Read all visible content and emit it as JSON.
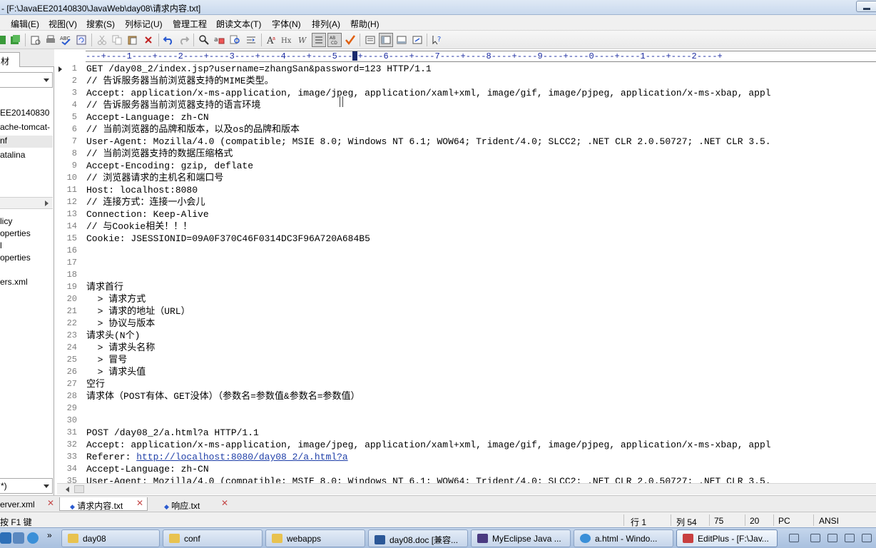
{
  "window": {
    "title": "- [F:\\JavaEE20140830\\JavaWeb\\day08\\请求内容.txt]"
  },
  "menu": [
    "编辑(E)",
    "视图(V)",
    "搜索(S)",
    "列标记(U)",
    "管理工程",
    "朗读文本(T)",
    "字体(N)",
    "排列(A)",
    "帮助(H)"
  ],
  "left_panel": {
    "tab_label": "材",
    "tree_items": [
      "EE20140830",
      "ache-tomcat-",
      "nf",
      "atalina"
    ],
    "file_items": [
      "licy",
      "operties",
      "l",
      "operties",
      "ers.xml"
    ],
    "filter_value": "*)"
  },
  "ruler": "---+----1----+----2----+----3----+----4----+----5---",
  "ruler_after": "+----6----+----7----+----8----+----9----+----0----+----1----+----2----+",
  "editor": {
    "lines": [
      {
        "n": "1",
        "t": "GET /day08_2/index.jsp?username=zhangSan&password=123 HTTP/1.1"
      },
      {
        "n": "2",
        "t": "// 告诉服务器当前浏览器支持的MIME类型。"
      },
      {
        "n": "3",
        "t": "Accept: application/x-ms-application, image/jpeg, application/xaml+xml, image/gif, image/pjpeg, application/x-ms-xbap, appl"
      },
      {
        "n": "4",
        "t": "// 告诉服务器当前浏览器支持的语言环境"
      },
      {
        "n": "5",
        "t": "Accept-Language: zh-CN"
      },
      {
        "n": "6",
        "t": "// 当前浏览器的品牌和版本，以及os的品牌和版本"
      },
      {
        "n": "7",
        "t": "User-Agent: Mozilla/4.0 (compatible; MSIE 8.0; Windows NT 6.1; WOW64; Trident/4.0; SLCC2; .NET CLR 2.0.50727; .NET CLR 3.5."
      },
      {
        "n": "8",
        "t": "// 当前浏览器支持的数据压缩格式"
      },
      {
        "n": "9",
        "t": "Accept-Encoding: gzip, deflate"
      },
      {
        "n": "10",
        "t": "// 浏览器请求的主机名和端口号"
      },
      {
        "n": "11",
        "t": "Host: localhost:8080"
      },
      {
        "n": "12",
        "t": "// 连接方式：连接一小会儿"
      },
      {
        "n": "13",
        "t": "Connection: Keep-Alive"
      },
      {
        "n": "14",
        "t": "// 与Cookie相关！！！"
      },
      {
        "n": "15",
        "t": "Cookie: JSESSIONID=09A0F370C46F0314DC3F96A720A684B5"
      },
      {
        "n": "16",
        "t": ""
      },
      {
        "n": "17",
        "t": ""
      },
      {
        "n": "18",
        "t": ""
      },
      {
        "n": "19",
        "t": "请求首行"
      },
      {
        "n": "20",
        "t": "  > 请求方式"
      },
      {
        "n": "21",
        "t": "  > 请求的地址（URL）"
      },
      {
        "n": "22",
        "t": "  > 协议与版本"
      },
      {
        "n": "23",
        "t": "请求头(N个)"
      },
      {
        "n": "24",
        "t": "  > 请求头名称"
      },
      {
        "n": "25",
        "t": "  > 冒号"
      },
      {
        "n": "26",
        "t": "  > 请求头值"
      },
      {
        "n": "27",
        "t": "空行"
      },
      {
        "n": "28",
        "t": "请求体（POST有体、GET没体）（参数名=参数值&参数名=参数值）"
      },
      {
        "n": "29",
        "t": ""
      },
      {
        "n": "30",
        "t": ""
      },
      {
        "n": "31",
        "t": "POST /day08_2/a.html?a HTTP/1.1"
      },
      {
        "n": "32",
        "t": "Accept: application/x-ms-application, image/jpeg, application/xaml+xml, image/gif, image/pjpeg, application/x-ms-xbap, appl"
      },
      {
        "n": "33",
        "t": "Referer: ",
        "link": "http://localhost:8080/day08_2/a.html?a"
      },
      {
        "n": "34",
        "t": "Accept-Language: zh-CN"
      },
      {
        "n": "35",
        "t": "User-Agent: Mozilla/4.0 (compatible; MSIE 8.0; Windows NT 6.1; WOW64; Trident/4.0; SLCC2; .NET CLR 2.0.50727; .NET CLR 3.5."
      }
    ]
  },
  "doc_tabs": [
    {
      "label": "erver.xml",
      "active": false
    },
    {
      "label": "请求内容.txt",
      "active": true
    },
    {
      "label": "响应.txt",
      "active": false
    }
  ],
  "status": {
    "hint": "按 F1 键",
    "row": "行 1",
    "col": "列 54",
    "v1": "75",
    "v2": "20",
    "mode": "PC",
    "encoding": "ANSI"
  },
  "taskbar": {
    "tasks": [
      "day08",
      "conf",
      "webapps",
      "day08.doc [兼容...",
      "MyEclipse Java ...",
      "a.html - Windo...",
      "EditPlus - [F:\\Jav..."
    ],
    "chevron": "»"
  },
  "colors": {
    "ruler_text": "#1a2aa0",
    "link": "#1f3fa8",
    "close_x": "#c54a4a"
  }
}
